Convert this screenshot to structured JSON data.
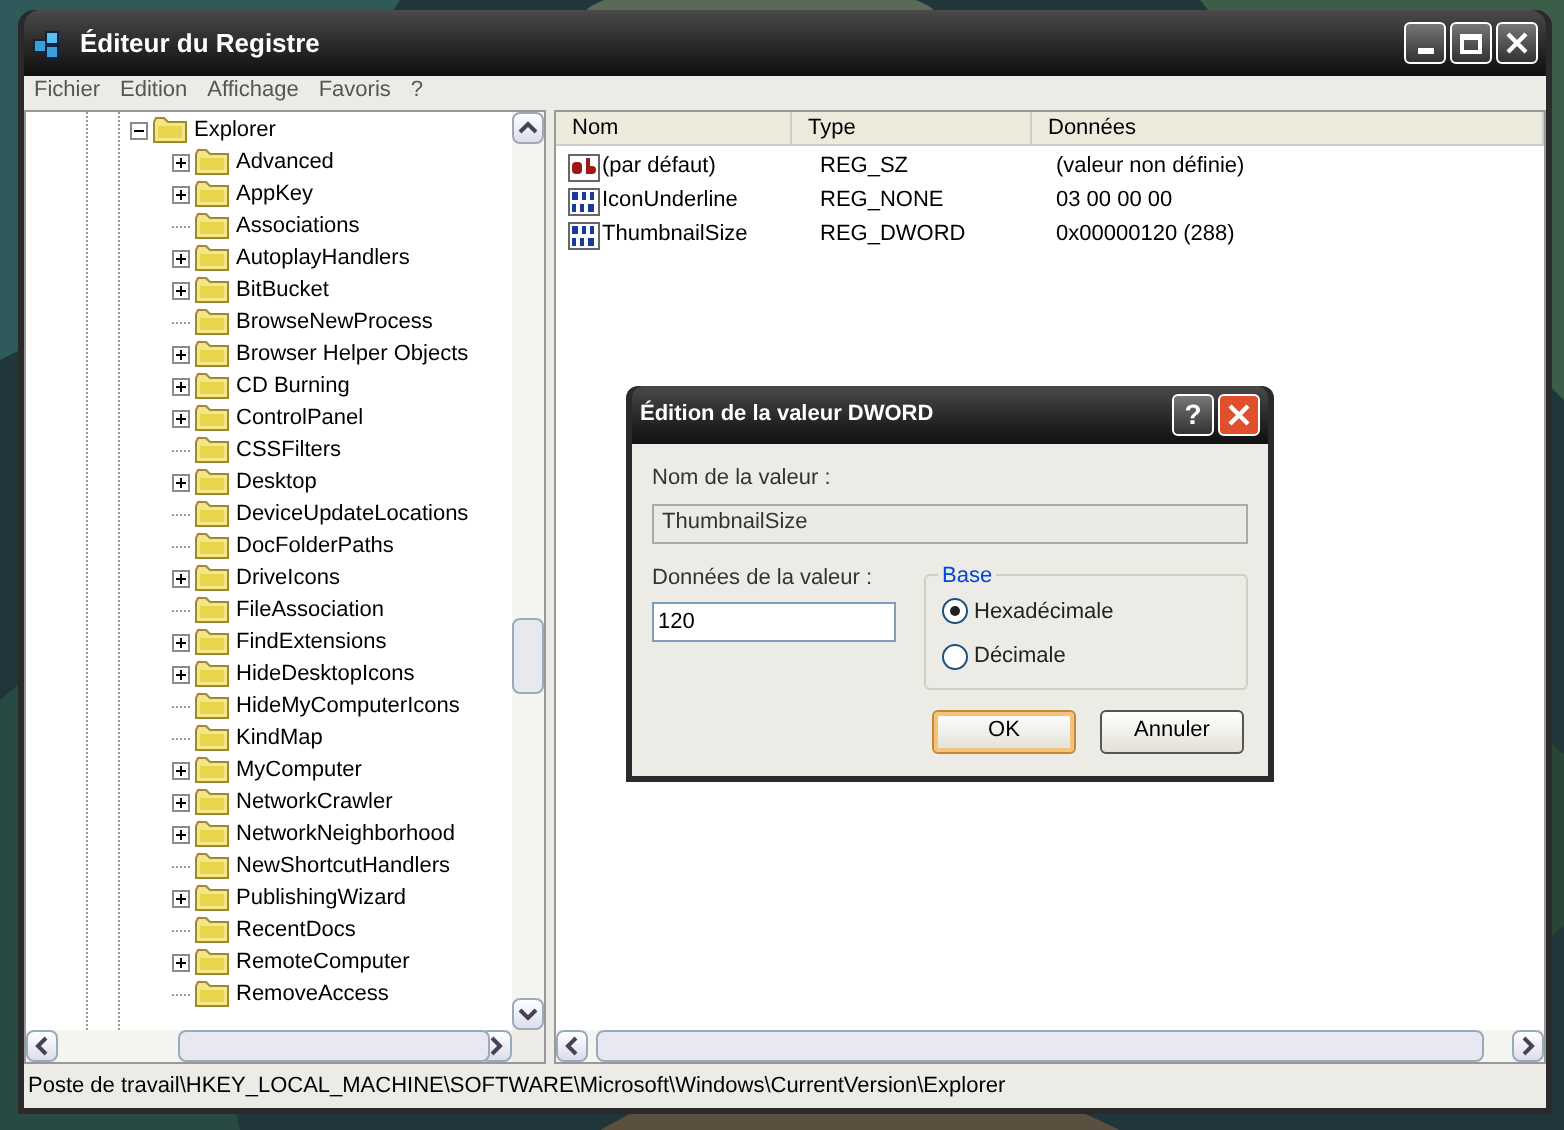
{
  "window": {
    "title": "Éditeur du Registre",
    "menu": [
      "Fichier",
      "Edition",
      "Affichage",
      "Favoris",
      "?"
    ]
  },
  "tree": {
    "label": "Explorer",
    "expanded": true,
    "children": [
      {
        "label": "Advanced",
        "expandable": true
      },
      {
        "label": "AppKey",
        "expandable": true
      },
      {
        "label": "Associations",
        "expandable": false
      },
      {
        "label": "AutoplayHandlers",
        "expandable": true
      },
      {
        "label": "BitBucket",
        "expandable": true
      },
      {
        "label": "BrowseNewProcess",
        "expandable": false
      },
      {
        "label": "Browser Helper Objects",
        "expandable": true
      },
      {
        "label": "CD Burning",
        "expandable": true
      },
      {
        "label": "ControlPanel",
        "expandable": true
      },
      {
        "label": "CSSFilters",
        "expandable": false
      },
      {
        "label": "Desktop",
        "expandable": true
      },
      {
        "label": "DeviceUpdateLocations",
        "expandable": false
      },
      {
        "label": "DocFolderPaths",
        "expandable": false
      },
      {
        "label": "DriveIcons",
        "expandable": true
      },
      {
        "label": "FileAssociation",
        "expandable": false
      },
      {
        "label": "FindExtensions",
        "expandable": true
      },
      {
        "label": "HideDesktopIcons",
        "expandable": true
      },
      {
        "label": "HideMyComputerIcons",
        "expandable": false
      },
      {
        "label": "KindMap",
        "expandable": false
      },
      {
        "label": "MyComputer",
        "expandable": true
      },
      {
        "label": "NetworkCrawler",
        "expandable": true
      },
      {
        "label": "NetworkNeighborhood",
        "expandable": true
      },
      {
        "label": "NewShortcutHandlers",
        "expandable": false
      },
      {
        "label": "PublishingWizard",
        "expandable": true
      },
      {
        "label": "RecentDocs",
        "expandable": false
      },
      {
        "label": "RemoteComputer",
        "expandable": true
      },
      {
        "label": "RemoveAccess",
        "expandable": false
      }
    ]
  },
  "values": {
    "columns": [
      "Nom",
      "Type",
      "Données"
    ],
    "rows": [
      {
        "kind": "string",
        "name": "(par défaut)",
        "type": "REG_SZ",
        "data": "(valeur non définie)"
      },
      {
        "kind": "binary",
        "name": "IconUnderline",
        "type": "REG_NONE",
        "data": "03 00 00 00"
      },
      {
        "kind": "binary",
        "name": "ThumbnailSize",
        "type": "REG_DWORD",
        "data": "0x00000120 (288)"
      }
    ]
  },
  "dialog": {
    "title": "Édition de la valeur DWORD",
    "help": "?",
    "name_label": "Nom de la valeur :",
    "name_value": "ThumbnailSize",
    "data_label": "Données de la valeur :",
    "data_value": "120",
    "base_label": "Base",
    "bases": [
      {
        "label": "Hexadécimale",
        "selected": true
      },
      {
        "label": "Décimale",
        "selected": false
      }
    ],
    "buttons": [
      {
        "label": "OK",
        "default": true
      },
      {
        "label": "Annuler",
        "default": false
      }
    ]
  },
  "status_bar": "Poste de travail\\HKEY_LOCAL_MACHINE\\SOFTWARE\\Microsoft\\Windows\\CurrentVersion\\Explorer"
}
